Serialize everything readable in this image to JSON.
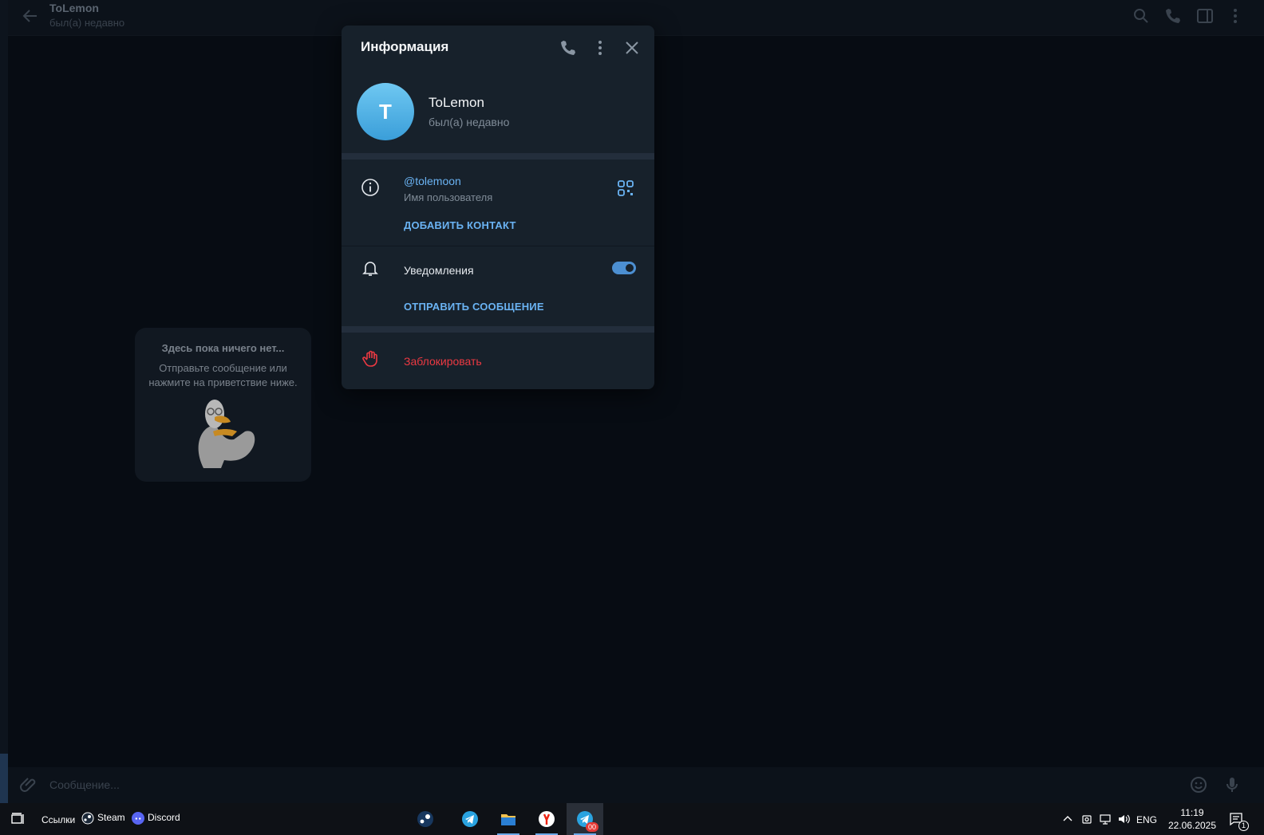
{
  "chat": {
    "title": "ToLemon",
    "status": "был(а) недавно"
  },
  "empty_state": {
    "heading": "Здесь пока ничего нет...",
    "hint": "Отправьте сообщение или нажмите на приветствие ниже."
  },
  "input": {
    "placeholder": "Сообщение..."
  },
  "dialog": {
    "title": "Информация",
    "avatar_letter": "T",
    "name": "ToLemon",
    "status": "был(а) недавно",
    "username": "@tolemoon",
    "username_label": "Имя пользователя",
    "add_contact": "ДОБАВИТЬ КОНТАКТ",
    "notifications_label": "Уведомления",
    "notifications_on": true,
    "send_message": "ОТПРАВИТЬ СООБЩЕНИЕ",
    "block": "Заблокировать"
  },
  "taskbar": {
    "links_label": "Ссылки",
    "steam_label": "Steam",
    "discord_label": "Discord",
    "telegram_badge": "00",
    "language": "ENG",
    "time": "11:19",
    "date": "22.06.2025",
    "notification_count": "1"
  },
  "colors": {
    "accent": "#6ab3f3",
    "danger": "#ec3942",
    "dialog_bg": "#17212b",
    "toggle": "#4c8fd1"
  }
}
